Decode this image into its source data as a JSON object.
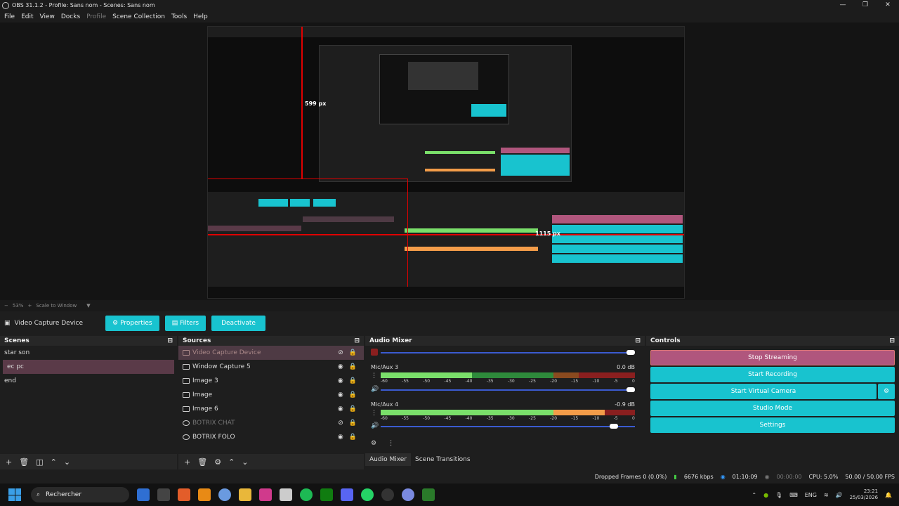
{
  "window": {
    "title": "OBS 31.1.2 - Profile: Sans nom - Scenes: Sans nom",
    "controls": [
      "—",
      "❐",
      "✕"
    ]
  },
  "menu": {
    "items": [
      "File",
      "Edit",
      "View",
      "Docks",
      "Profile",
      "Scene Collection",
      "Tools",
      "Help"
    ]
  },
  "preview": {
    "measure_vertical": "599 px",
    "measure_horizontal": "1115 px"
  },
  "zoom": {
    "minus": "−",
    "level": "53%",
    "plus": "+",
    "mode": "Scale to Window"
  },
  "source_toolbar": {
    "source_name": "Video Capture Device",
    "properties": "Properties",
    "filters": "Filters",
    "deactivate": "Deactivate"
  },
  "scenes": {
    "title": "Scenes",
    "items": [
      "star son",
      "ec pc",
      "end"
    ],
    "selected": "ec pc"
  },
  "sources": {
    "title": "Sources",
    "items": [
      {
        "name": "Video Capture Device"
      },
      {
        "name": "Window Capture 5"
      },
      {
        "name": "Image 3"
      },
      {
        "name": "Image"
      },
      {
        "name": "Image 6"
      },
      {
        "name": "BOTRIX CHAT"
      },
      {
        "name": "BOTRIX FOLO"
      }
    ]
  },
  "mixer": {
    "title": "Audio Mixer",
    "channels": [
      {
        "name": "Mic/Aux 3",
        "db": "0.0 dB"
      },
      {
        "name": "Mic/Aux 4",
        "db": "-0.9 dB"
      }
    ],
    "ticks": [
      "-60",
      "-55",
      "-50",
      "-45",
      "-40",
      "-35",
      "-30",
      "-25",
      "-20",
      "-15",
      "-10",
      "-5",
      "0"
    ],
    "tabs": [
      "Audio Mixer",
      "Scene Transitions"
    ]
  },
  "controls": {
    "title": "Controls",
    "stop_streaming": "Stop Streaming",
    "start_recording": "Start Recording",
    "start_virtual_camera": "Start Virtual Camera",
    "studio_mode": "Studio Mode",
    "settings": "Settings"
  },
  "status": {
    "dropped": "Dropped Frames 0 (0.0%)",
    "kbps": "6676 kbps",
    "stream_time": "01:10:09",
    "rec_time": "00:00:00",
    "cpu": "CPU: 5.0%",
    "fps": "50.00 / 50.00 FPS"
  },
  "taskbar": {
    "search": "Rechercher",
    "lang": "ENG",
    "time": "23:21",
    "date": "25/03/2026"
  },
  "colors": {
    "accent": "#18c3cf",
    "stream": "#b0567d",
    "selected": "#5a3a48"
  }
}
